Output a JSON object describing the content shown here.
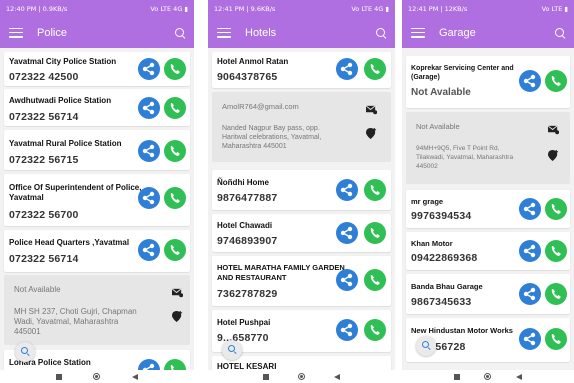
{
  "colors": {
    "accent": "#b06fe0",
    "share": "#2f7fd6",
    "call": "#2fbf55"
  },
  "police": {
    "status": {
      "left": "12:40 PM | 0.9KB/s",
      "right": "Vo LTE 4G ▮"
    },
    "title": "Police",
    "items": [
      {
        "name": "Yavatmal City Police Station",
        "phone": "072322 42500"
      },
      {
        "name": "Awdhutwadi Police Station",
        "phone": "072322 56714"
      },
      {
        "name": "Yavatmal Rural Police Station",
        "phone": "072322 56715"
      },
      {
        "name": "Office Of Superintendent of Police,",
        "name2": "Yavatmal",
        "phone": "072322 56700"
      },
      {
        "name": "Police Head Quarters ,Yavatmal",
        "phone": "072322 56714"
      },
      {
        "name": "Lohara Police Station"
      }
    ],
    "details": {
      "email": "Not Available",
      "address1": "MH SH 237, Choti Gujri, Chapman",
      "address2": "Wadi, Yavatmal, Maharashtra",
      "address3": "445001"
    }
  },
  "hotels": {
    "status": {
      "left": "12:41 PM | 9.6KB/s",
      "right": "Vo LTE 4G ▮"
    },
    "title": "Hotels",
    "items": [
      {
        "name": "Hotel Anmol Ratan",
        "phone": "9064378765"
      },
      {
        "name": "Ñoñdhi Home",
        "phone": "9876477887"
      },
      {
        "name": "Hotel Chawadi",
        "phone": "9746893907"
      },
      {
        "name": "HOTEL MARATHA FAMILY GARDEN",
        "name2": "AND RESTAURANT",
        "phone": "7362787829"
      },
      {
        "name": "Hotel Pushpai",
        "phone": "9...658770"
      },
      {
        "name": "HOTEL KESARI"
      }
    ],
    "details": {
      "email": "AmolR764@gmail.com",
      "address1": "Nanded Nagpur Bay pass, opp.",
      "address2": "Haritwal celebrations, Yavatmal,",
      "address3": "Maharashtra 445001"
    }
  },
  "garage": {
    "status": {
      "left": "12:41 PM | 12KB/s",
      "right": "Vo LTE ▮"
    },
    "title": "Garage",
    "items": [
      {
        "name": "Koprekar Servicing Center and",
        "name2": "(Garage)",
        "phone": "Not Avalable"
      },
      {
        "name": "mr grage",
        "phone": "9976394534"
      },
      {
        "name": "Khan Motor",
        "phone": "09422869368"
      },
      {
        "name": "Banda Bhau Garage",
        "phone": "9867345633"
      },
      {
        "name": "New Hindustan Motor Works",
        "phone": "...56728"
      }
    ],
    "details": {
      "email": "Not Available",
      "address1": "94MH+9Q5, Five T Point Rd,",
      "address2": "Tilakwadi, Yavatmal, Maharashtra",
      "address3": "445002"
    }
  },
  "icons": [
    "menu-icon",
    "search-icon",
    "share-icon",
    "call-icon",
    "mail-icon",
    "add-location-icon",
    "zoom-icon"
  ]
}
